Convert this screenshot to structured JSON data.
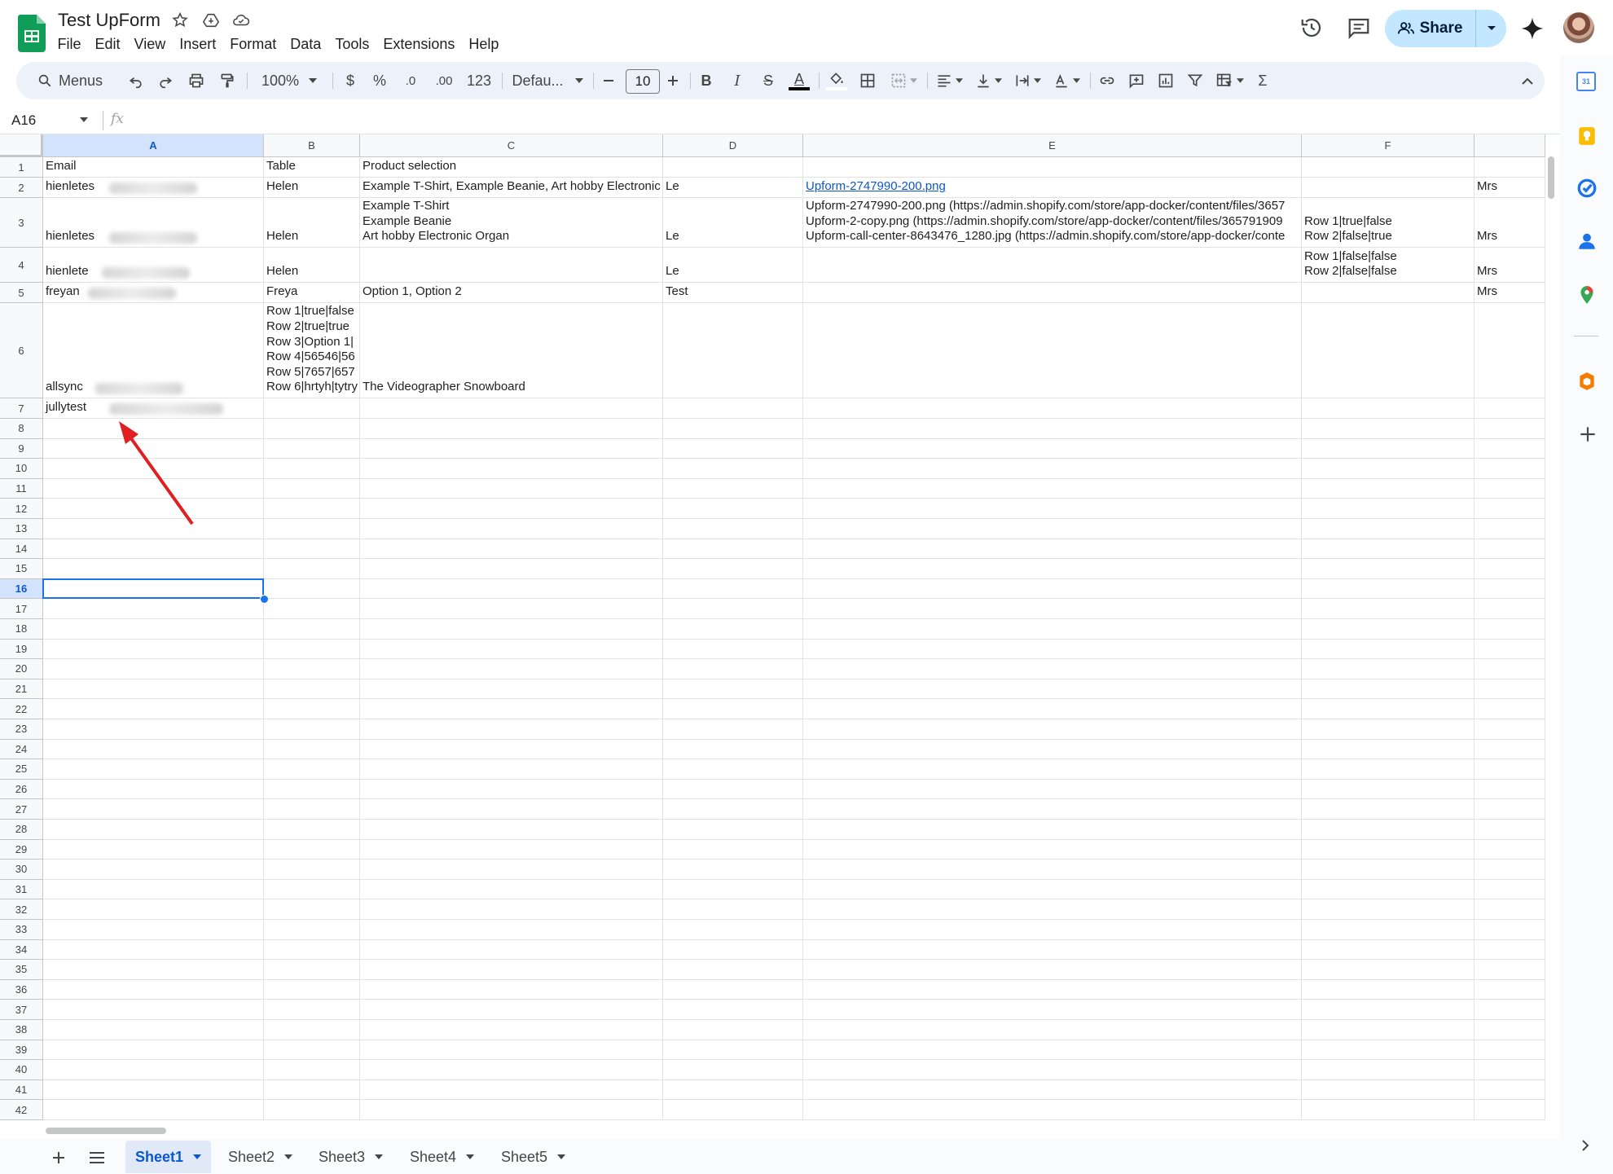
{
  "document": {
    "title": "Test UpForm",
    "menus": [
      "File",
      "Edit",
      "View",
      "Insert",
      "Format",
      "Data",
      "Tools",
      "Extensions",
      "Help"
    ]
  },
  "header": {
    "share_label": "Share"
  },
  "toolbar": {
    "menus_label": "Menus",
    "zoom": "100%",
    "currency": "$",
    "percent": "%",
    "decrease_decimal": ".0",
    "increase_decimal": ".00",
    "number_format": "123",
    "font_family": "Defau...",
    "font_size": "10",
    "bold": "B",
    "italic": "I",
    "strikethrough": "S",
    "text_color": "A",
    "sum": "Σ"
  },
  "formula_bar": {
    "name_box": "A16",
    "fx": "fx",
    "value": ""
  },
  "grid": {
    "columns": [
      "A",
      "B",
      "C",
      "D",
      "E",
      "F",
      ""
    ],
    "selected_column": "A",
    "selected_row": "16",
    "row_numbers": [
      "1",
      "2",
      "3",
      "4",
      "5",
      "6",
      "7",
      "8",
      "9",
      "10",
      "11",
      "12",
      "13",
      "14",
      "15",
      "16",
      "17",
      "18",
      "19",
      "20",
      "21",
      "22",
      "23",
      "24",
      "25",
      "26",
      "27",
      "28",
      "29",
      "30",
      "31",
      "32",
      "33",
      "34",
      "35",
      "36",
      "37",
      "38",
      "39",
      "40",
      "41",
      "42"
    ],
    "rows": [
      [
        "Email",
        "Table",
        "Product selection",
        "",
        "",
        "",
        ""
      ],
      [
        "hienletes",
        "Helen",
        "Example T-Shirt, Example Beanie, Art hobby Electronic Organ",
        "Le",
        "Upform-2747990-200.png",
        "",
        "Mrs"
      ],
      [
        "hienletes",
        "Helen",
        "Example T-Shirt\nExample Beanie\nArt hobby Electronic Organ",
        "Le",
        "Upform-2747990-200.png (https://admin.shopify.com/store/app-docker/content/files/3657\nUpform-2-copy.png (https://admin.shopify.com/store/app-docker/content/files/365791909\nUpform-call-center-8643476_1280.jpg (https://admin.shopify.com/store/app-docker/conte",
        "Row 1|true|false\nRow 2|false|true",
        "Mrs"
      ],
      [
        "hienlete",
        "Helen",
        "",
        "Le",
        "",
        "Row 1|false|false\nRow 2|false|false",
        "Mrs"
      ],
      [
        "freyan",
        "Freya",
        "Option 1, Option 2",
        "Test",
        "",
        "",
        "Mrs"
      ],
      [
        "allsync",
        "Row 1|true|false\nRow 2|true|true\nRow 3|Option 1|\nRow 4|56546|56\nRow 5|7657|657\nRow 6|hrtyh|tytry",
        "The Videographer Snowboard",
        "",
        "",
        "",
        ""
      ],
      [
        "jullytest",
        "",
        "",
        "",
        "",
        "",
        ""
      ]
    ]
  },
  "sheets": {
    "tabs": [
      "Sheet1",
      "Sheet2",
      "Sheet3",
      "Sheet4",
      "Sheet5"
    ],
    "active": "Sheet1"
  },
  "side_panel": {
    "calendar_day": "31"
  },
  "colors": {
    "accent": "#0b57d0",
    "share_bg": "#c2e7ff",
    "sheets_green": "#0f9d58",
    "annotation_arrow": "#e02020"
  },
  "icons": [
    "sheets-logo",
    "star-icon",
    "move-to-drive-icon",
    "cloud-status-icon",
    "history-icon",
    "comments-icon",
    "people-icon",
    "gemini-icon",
    "search-icon",
    "undo-icon",
    "redo-icon",
    "print-icon",
    "paint-format-icon",
    "fill-color-icon",
    "borders-icon",
    "merge-icon",
    "align-icon",
    "valign-icon",
    "text-wrap-icon",
    "text-rotation-icon",
    "link-icon",
    "comment-add-icon",
    "chart-icon",
    "filter-icon",
    "filter-views-icon",
    "collapse-icon",
    "calendar-icon",
    "keep-icon",
    "tasks-icon",
    "contacts-icon",
    "maps-icon",
    "addon-icon",
    "add-icon",
    "chevron-right-icon",
    "add-sheet-icon",
    "all-sheets-icon"
  ]
}
